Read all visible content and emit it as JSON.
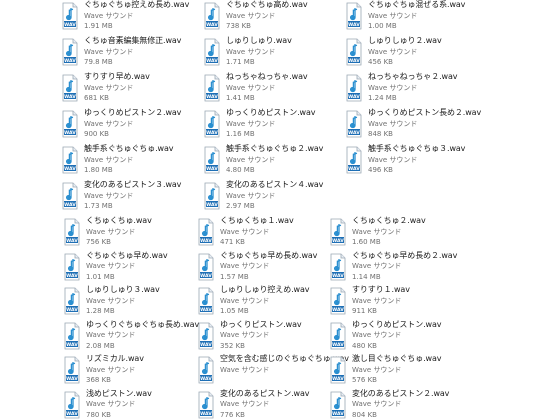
{
  "file_type_label": "Wave サウンド",
  "icon": "wav-audio-file-icon",
  "icon_badge": "WAV",
  "colors": {
    "name": "#1a1a1a",
    "meta": "#707070",
    "note": "#2a8fd0",
    "badge": "#1e6fb5"
  },
  "files_top": [
    {
      "name": "ぐちゅぐちゅ控えめ長め.wav",
      "size": "1.91 MB"
    },
    {
      "name": "ぐちゅぐちゅ高め.wav",
      "size": "738 KB"
    },
    {
      "name": "ぐちゅぐちゅ混ぜる系.wav",
      "size": "1.00 MB"
    },
    {
      "name": "くちゅ音素編集無修正.wav",
      "size": "79.8 MB"
    },
    {
      "name": "しゅりしゅり.wav",
      "size": "1.71 MB"
    },
    {
      "name": "しゅりしゅり２.wav",
      "size": "456 KB"
    },
    {
      "name": "すりすり早め.wav",
      "size": "681 KB"
    },
    {
      "name": "ねっちゃねっちゃ.wav",
      "size": "1.41 MB"
    },
    {
      "name": "ねっちゃねっちゃ２.wav",
      "size": "1.24 MB"
    },
    {
      "name": "ゆっくりめピストン２.wav",
      "size": "900 KB"
    },
    {
      "name": "ゆっくりめピストン.wav",
      "size": "1.16 MB"
    },
    {
      "name": "ゆっくりめピストン長め２.wav",
      "size": "848 KB"
    },
    {
      "name": "触手系ぐちゅぐちゅ.wav",
      "size": "1.80 MB"
    },
    {
      "name": "触手系ぐちゅぐちゅ２.wav",
      "size": "4.80 MB"
    },
    {
      "name": "触手系ぐちゅぐちゅ３.wav",
      "size": "496 KB"
    },
    {
      "name": "変化のあるピストン３.wav",
      "size": "1.73 MB"
    },
    {
      "name": "変化のあるピストン４.wav",
      "size": "2.97 MB"
    }
  ],
  "files_bottom": [
    {
      "name": "くちゅくちゅ.wav",
      "size": "756 KB"
    },
    {
      "name": "くちゅくちゅ１.wav",
      "size": "471 KB"
    },
    {
      "name": "くちゅくちゅ２.wav",
      "size": "1.60 MB"
    },
    {
      "name": "ぐちゅぐちゅ早め.wav",
      "size": "1.01 MB"
    },
    {
      "name": "ぐちゅぐちゅ早め長め.wav",
      "size": "1.57 MB"
    },
    {
      "name": "ぐちゅぐちゅ早め長め２.wav",
      "size": "1.14 MB"
    },
    {
      "name": "しゅりしゅり３.wav",
      "size": "1.28 MB"
    },
    {
      "name": "しゅりしゅり控えめ.wav",
      "size": "1.05 MB"
    },
    {
      "name": "すりすり１.wav",
      "size": "911 KB"
    },
    {
      "name": "ゆっくりぐちゅぐちゅ長め.wav",
      "size": "2.08 MB"
    },
    {
      "name": "ゆっくりピストン.wav",
      "size": "352 KB"
    },
    {
      "name": "ゆっくりめピストン.wav",
      "size": "480 KB"
    },
    {
      "name": "リズミカル.wav",
      "size": "368 KB"
    },
    {
      "name": "空気を含む感じのぐちゅぐちゅ.wav",
      "size": ""
    },
    {
      "name": "激し目ぐちゅぐちゅ.wav",
      "size": "576 KB"
    },
    {
      "name": "浅めピストン.wav",
      "size": "780 KB"
    },
    {
      "name": "変化のあるピストン.wav",
      "size": "776 KB"
    },
    {
      "name": "変化のあるピストン２.wav",
      "size": "804 KB"
    }
  ]
}
